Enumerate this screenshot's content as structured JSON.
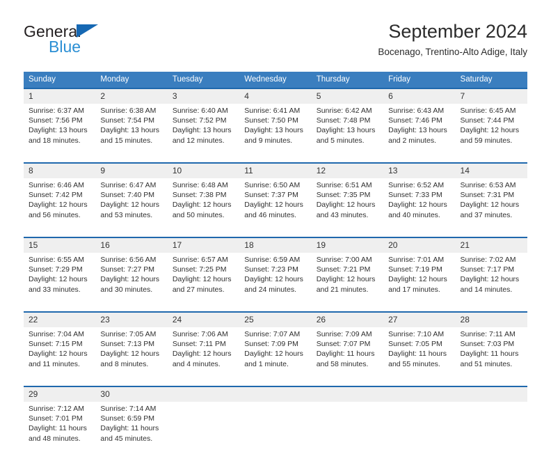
{
  "brand": {
    "name_top": "General",
    "name_bottom": "Blue",
    "triangle_color": "#1668b3",
    "blue_text_color": "#2b8fd4"
  },
  "header": {
    "title": "September 2024",
    "subtitle": "Bocenago, Trentino-Alto Adige, Italy"
  },
  "theme": {
    "header_row_bg": "#3a7ebf",
    "daynum_bg": "#efefef",
    "week_border": "#1f68ad"
  },
  "calendar": {
    "weekday_headers": [
      "Sunday",
      "Monday",
      "Tuesday",
      "Wednesday",
      "Thursday",
      "Friday",
      "Saturday"
    ],
    "weeks": [
      [
        {
          "day": "1",
          "sunrise": "Sunrise: 6:37 AM",
          "sunset": "Sunset: 7:56 PM",
          "daylight_1": "Daylight: 13 hours",
          "daylight_2": "and 18 minutes."
        },
        {
          "day": "2",
          "sunrise": "Sunrise: 6:38 AM",
          "sunset": "Sunset: 7:54 PM",
          "daylight_1": "Daylight: 13 hours",
          "daylight_2": "and 15 minutes."
        },
        {
          "day": "3",
          "sunrise": "Sunrise: 6:40 AM",
          "sunset": "Sunset: 7:52 PM",
          "daylight_1": "Daylight: 13 hours",
          "daylight_2": "and 12 minutes."
        },
        {
          "day": "4",
          "sunrise": "Sunrise: 6:41 AM",
          "sunset": "Sunset: 7:50 PM",
          "daylight_1": "Daylight: 13 hours",
          "daylight_2": "and 9 minutes."
        },
        {
          "day": "5",
          "sunrise": "Sunrise: 6:42 AM",
          "sunset": "Sunset: 7:48 PM",
          "daylight_1": "Daylight: 13 hours",
          "daylight_2": "and 5 minutes."
        },
        {
          "day": "6",
          "sunrise": "Sunrise: 6:43 AM",
          "sunset": "Sunset: 7:46 PM",
          "daylight_1": "Daylight: 13 hours",
          "daylight_2": "and 2 minutes."
        },
        {
          "day": "7",
          "sunrise": "Sunrise: 6:45 AM",
          "sunset": "Sunset: 7:44 PM",
          "daylight_1": "Daylight: 12 hours",
          "daylight_2": "and 59 minutes."
        }
      ],
      [
        {
          "day": "8",
          "sunrise": "Sunrise: 6:46 AM",
          "sunset": "Sunset: 7:42 PM",
          "daylight_1": "Daylight: 12 hours",
          "daylight_2": "and 56 minutes."
        },
        {
          "day": "9",
          "sunrise": "Sunrise: 6:47 AM",
          "sunset": "Sunset: 7:40 PM",
          "daylight_1": "Daylight: 12 hours",
          "daylight_2": "and 53 minutes."
        },
        {
          "day": "10",
          "sunrise": "Sunrise: 6:48 AM",
          "sunset": "Sunset: 7:38 PM",
          "daylight_1": "Daylight: 12 hours",
          "daylight_2": "and 50 minutes."
        },
        {
          "day": "11",
          "sunrise": "Sunrise: 6:50 AM",
          "sunset": "Sunset: 7:37 PM",
          "daylight_1": "Daylight: 12 hours",
          "daylight_2": "and 46 minutes."
        },
        {
          "day": "12",
          "sunrise": "Sunrise: 6:51 AM",
          "sunset": "Sunset: 7:35 PM",
          "daylight_1": "Daylight: 12 hours",
          "daylight_2": "and 43 minutes."
        },
        {
          "day": "13",
          "sunrise": "Sunrise: 6:52 AM",
          "sunset": "Sunset: 7:33 PM",
          "daylight_1": "Daylight: 12 hours",
          "daylight_2": "and 40 minutes."
        },
        {
          "day": "14",
          "sunrise": "Sunrise: 6:53 AM",
          "sunset": "Sunset: 7:31 PM",
          "daylight_1": "Daylight: 12 hours",
          "daylight_2": "and 37 minutes."
        }
      ],
      [
        {
          "day": "15",
          "sunrise": "Sunrise: 6:55 AM",
          "sunset": "Sunset: 7:29 PM",
          "daylight_1": "Daylight: 12 hours",
          "daylight_2": "and 33 minutes."
        },
        {
          "day": "16",
          "sunrise": "Sunrise: 6:56 AM",
          "sunset": "Sunset: 7:27 PM",
          "daylight_1": "Daylight: 12 hours",
          "daylight_2": "and 30 minutes."
        },
        {
          "day": "17",
          "sunrise": "Sunrise: 6:57 AM",
          "sunset": "Sunset: 7:25 PM",
          "daylight_1": "Daylight: 12 hours",
          "daylight_2": "and 27 minutes."
        },
        {
          "day": "18",
          "sunrise": "Sunrise: 6:59 AM",
          "sunset": "Sunset: 7:23 PM",
          "daylight_1": "Daylight: 12 hours",
          "daylight_2": "and 24 minutes."
        },
        {
          "day": "19",
          "sunrise": "Sunrise: 7:00 AM",
          "sunset": "Sunset: 7:21 PM",
          "daylight_1": "Daylight: 12 hours",
          "daylight_2": "and 21 minutes."
        },
        {
          "day": "20",
          "sunrise": "Sunrise: 7:01 AM",
          "sunset": "Sunset: 7:19 PM",
          "daylight_1": "Daylight: 12 hours",
          "daylight_2": "and 17 minutes."
        },
        {
          "day": "21",
          "sunrise": "Sunrise: 7:02 AM",
          "sunset": "Sunset: 7:17 PM",
          "daylight_1": "Daylight: 12 hours",
          "daylight_2": "and 14 minutes."
        }
      ],
      [
        {
          "day": "22",
          "sunrise": "Sunrise: 7:04 AM",
          "sunset": "Sunset: 7:15 PM",
          "daylight_1": "Daylight: 12 hours",
          "daylight_2": "and 11 minutes."
        },
        {
          "day": "23",
          "sunrise": "Sunrise: 7:05 AM",
          "sunset": "Sunset: 7:13 PM",
          "daylight_1": "Daylight: 12 hours",
          "daylight_2": "and 8 minutes."
        },
        {
          "day": "24",
          "sunrise": "Sunrise: 7:06 AM",
          "sunset": "Sunset: 7:11 PM",
          "daylight_1": "Daylight: 12 hours",
          "daylight_2": "and 4 minutes."
        },
        {
          "day": "25",
          "sunrise": "Sunrise: 7:07 AM",
          "sunset": "Sunset: 7:09 PM",
          "daylight_1": "Daylight: 12 hours",
          "daylight_2": "and 1 minute."
        },
        {
          "day": "26",
          "sunrise": "Sunrise: 7:09 AM",
          "sunset": "Sunset: 7:07 PM",
          "daylight_1": "Daylight: 11 hours",
          "daylight_2": "and 58 minutes."
        },
        {
          "day": "27",
          "sunrise": "Sunrise: 7:10 AM",
          "sunset": "Sunset: 7:05 PM",
          "daylight_1": "Daylight: 11 hours",
          "daylight_2": "and 55 minutes."
        },
        {
          "day": "28",
          "sunrise": "Sunrise: 7:11 AM",
          "sunset": "Sunset: 7:03 PM",
          "daylight_1": "Daylight: 11 hours",
          "daylight_2": "and 51 minutes."
        }
      ],
      [
        {
          "day": "29",
          "sunrise": "Sunrise: 7:12 AM",
          "sunset": "Sunset: 7:01 PM",
          "daylight_1": "Daylight: 11 hours",
          "daylight_2": "and 48 minutes."
        },
        {
          "day": "30",
          "sunrise": "Sunrise: 7:14 AM",
          "sunset": "Sunset: 6:59 PM",
          "daylight_1": "Daylight: 11 hours",
          "daylight_2": "and 45 minutes."
        },
        {
          "day": "",
          "sunrise": "",
          "sunset": "",
          "daylight_1": "",
          "daylight_2": ""
        },
        {
          "day": "",
          "sunrise": "",
          "sunset": "",
          "daylight_1": "",
          "daylight_2": ""
        },
        {
          "day": "",
          "sunrise": "",
          "sunset": "",
          "daylight_1": "",
          "daylight_2": ""
        },
        {
          "day": "",
          "sunrise": "",
          "sunset": "",
          "daylight_1": "",
          "daylight_2": ""
        },
        {
          "day": "",
          "sunrise": "",
          "sunset": "",
          "daylight_1": "",
          "daylight_2": ""
        }
      ]
    ]
  }
}
